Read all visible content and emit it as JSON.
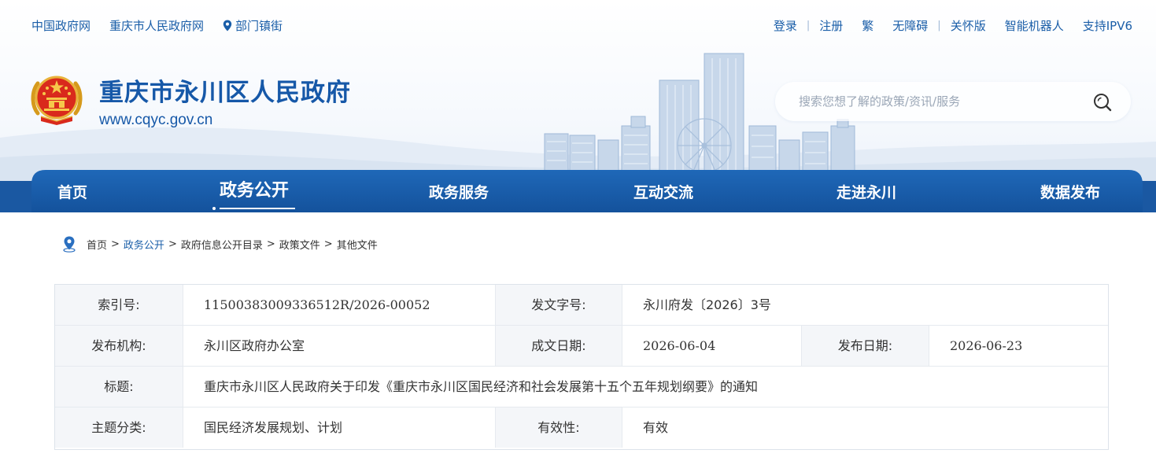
{
  "top_links_left": [
    {
      "label": "中国政府网"
    },
    {
      "label": "重庆市人民政府网"
    },
    {
      "label": "部门镇街",
      "icon": "location-pin-icon"
    }
  ],
  "top_links_right": [
    "登录",
    "注册",
    "繁",
    "无障碍",
    "关怀版",
    "智能机器人",
    "支持IPV6"
  ],
  "site": {
    "title": "重庆市永川区人民政府",
    "url": "www.cqyc.gov.cn"
  },
  "search": {
    "placeholder": "搜索您想了解的政策/资讯/服务"
  },
  "nav": {
    "items": [
      "首页",
      "政务公开",
      "政务服务",
      "互动交流",
      "走进永川",
      "数据发布"
    ],
    "active": "政务公开"
  },
  "breadcrumb": {
    "items": [
      "首页",
      "政务公开",
      "政府信息公开目录",
      "政策文件",
      "其他文件"
    ],
    "separator": ">"
  },
  "info": {
    "index_label": "索引号:",
    "index_value": "11500383009336512R/2026-00052",
    "docno_label": "发文字号:",
    "docno_value": "永川府发〔2026〕3号",
    "org_label": "发布机构:",
    "org_value": "永川区政府办公室",
    "created_label": "成文日期:",
    "created_value": "2026-06-04",
    "published_label": "发布日期:",
    "published_value": "2026-06-23",
    "title_label": "标题:",
    "title_value": "重庆市永川区人民政府关于印发《重庆市永川区国民经济和社会发展第十五个五年规划纲要》的通知",
    "topic_label": "主题分类:",
    "topic_value": "国民经济发展规划、计划",
    "validity_label": "有效性:",
    "validity_value": "有效"
  },
  "colors": {
    "brand_blue": "#1658a8",
    "nav_blue": "#1a5fae",
    "label_bg": "#f4f6f9",
    "border": "#e6eaef"
  }
}
